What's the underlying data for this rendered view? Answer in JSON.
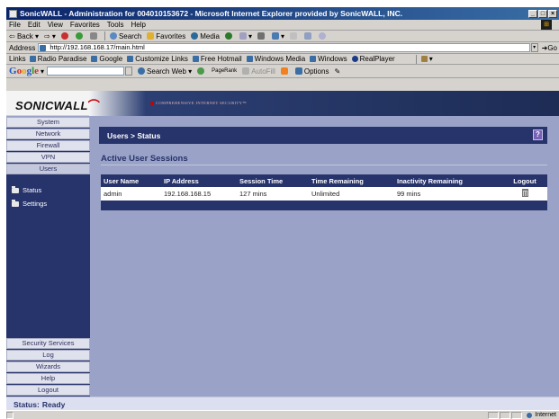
{
  "window": {
    "title": "SonicWALL - Administration for 004010153672 - Microsoft Internet Explorer provided by SonicWALL, INC.",
    "buttons": [
      "_",
      "□",
      "×"
    ]
  },
  "menu": {
    "items": [
      "File",
      "Edit",
      "View",
      "Favorites",
      "Tools",
      "Help"
    ]
  },
  "toolbar": {
    "back": "Back",
    "search": "Search",
    "favorites": "Favorites",
    "media": "Media"
  },
  "address": {
    "label": "Address",
    "url": "http://192.168.168.17/main.html",
    "go": "Go"
  },
  "links": {
    "label": "Links",
    "items": [
      "Radio Paradise",
      "Google",
      "Customize Links",
      "Free Hotmail",
      "Windows Media",
      "Windows",
      "RealPlayer"
    ]
  },
  "googlebar": {
    "search_web": "Search Web",
    "pagerank": "PageRank",
    "autofill": "AutoFill",
    "options": "Options"
  },
  "sonicwall": {
    "logo": "SONICWALL",
    "tagline": "COMPREHENSIVE INTERNET SECURITY™"
  },
  "sidebar": {
    "top_items": [
      "System",
      "Network",
      "Firewall",
      "VPN",
      "Users"
    ],
    "active": "Users",
    "sub_items": [
      "Status",
      "Settings"
    ],
    "bottom_items": [
      "Security Services",
      "Log",
      "Wizards",
      "Help",
      "Logout"
    ]
  },
  "page": {
    "title": "Users > Status",
    "help": "?",
    "section_title": "Active User Sessions"
  },
  "table": {
    "headers": [
      "User Name",
      "IP Address",
      "Session Time",
      "Time Remaining",
      "Inactivity Remaining",
      "Logout"
    ],
    "rows": [
      [
        "admin",
        "192.168.168.15",
        "127 mins",
        "Unlimited",
        "99 mins"
      ]
    ]
  },
  "status": {
    "label": "Status:",
    "value": "Ready"
  },
  "ie_status": {
    "zone": "Internet"
  },
  "colors": {
    "nav_dark": "#27336b",
    "content_bg": "#9aa3c7",
    "brand_red": "#c80000"
  }
}
